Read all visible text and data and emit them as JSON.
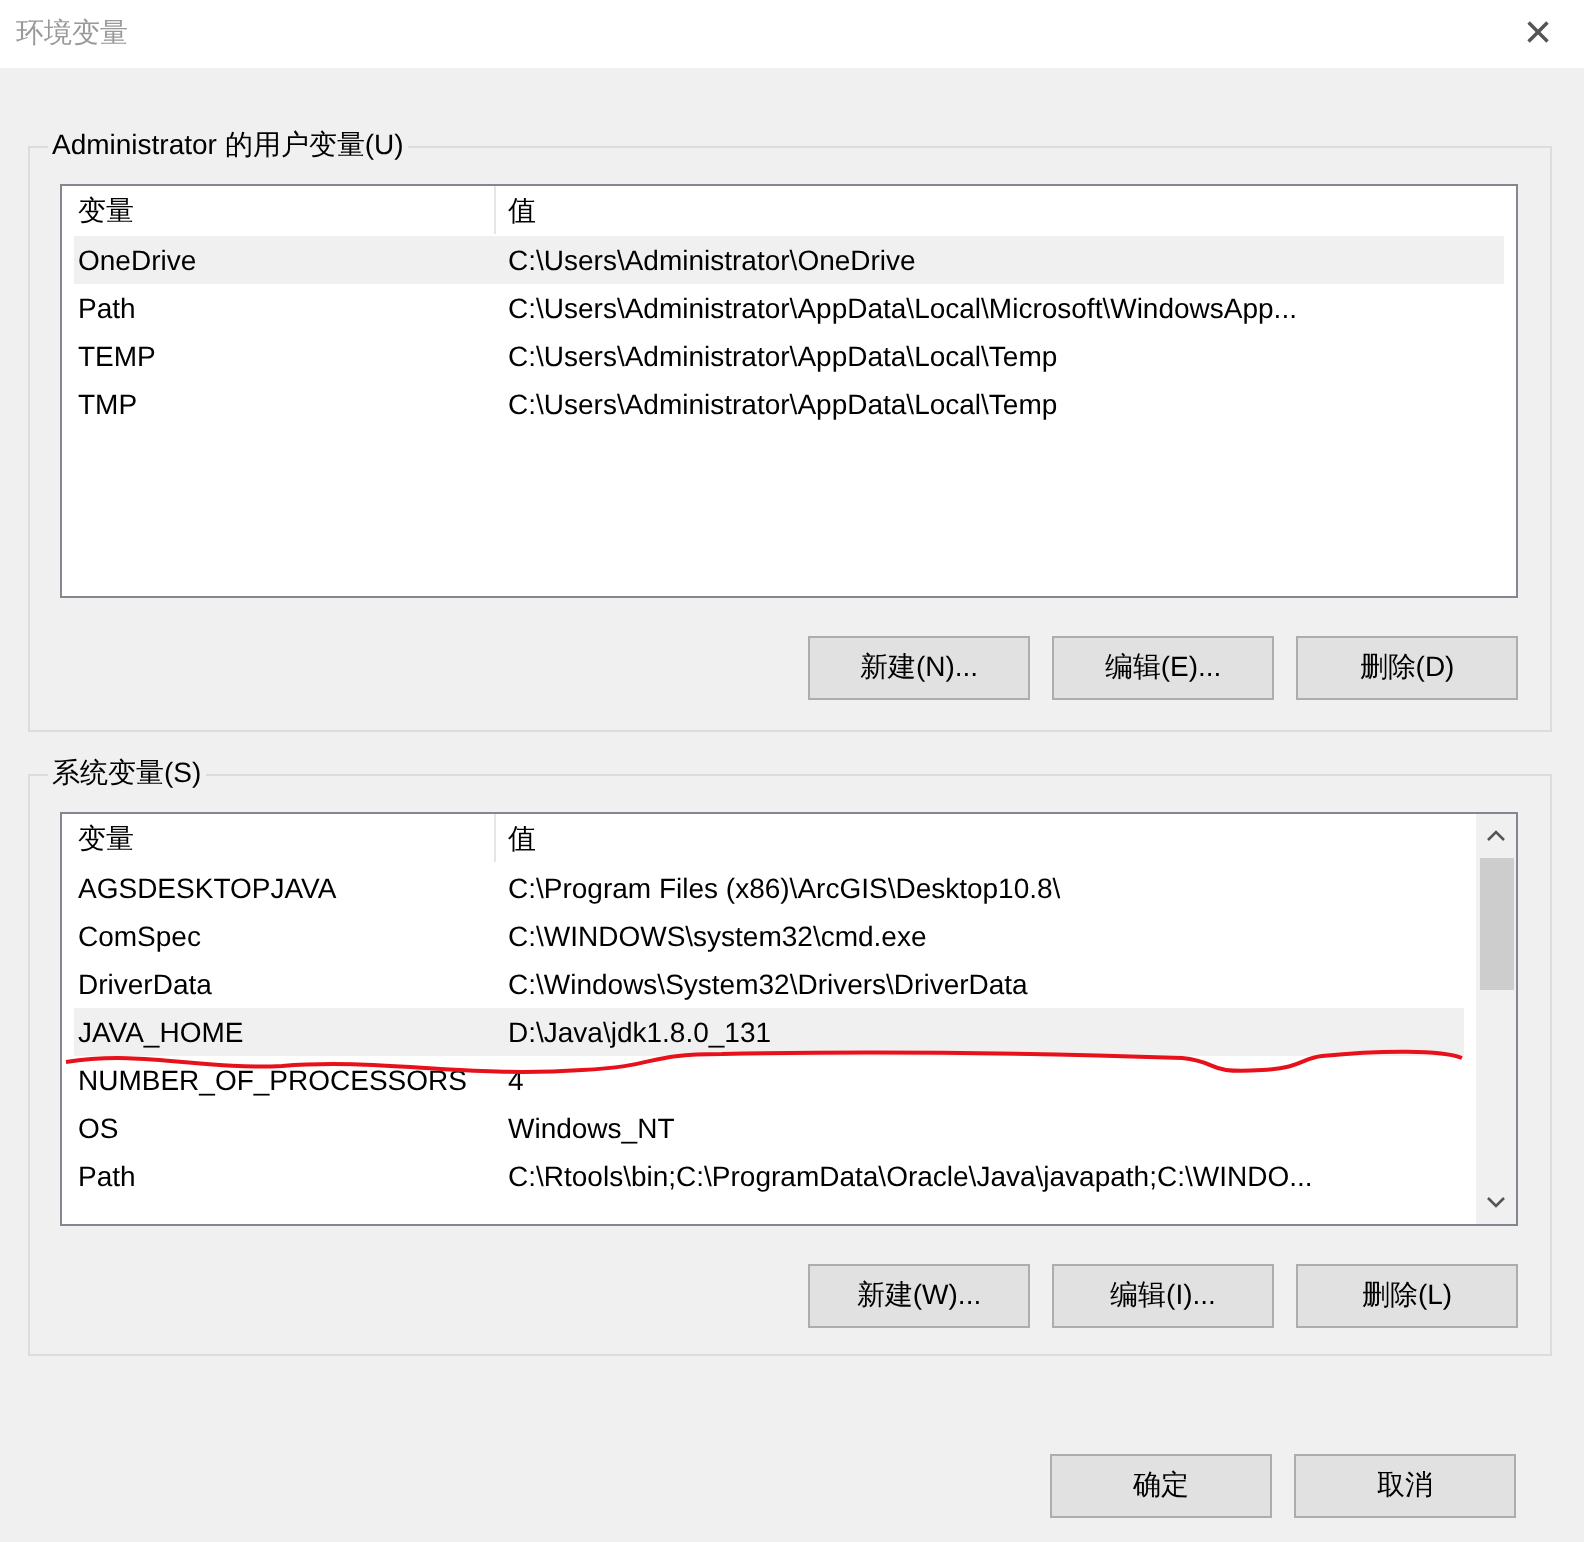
{
  "window": {
    "title": "环境变量",
    "close": "×"
  },
  "user_group": {
    "label": "Administrator 的用户变量(U)",
    "columns": [
      "变量",
      "值"
    ],
    "rows": [
      {
        "name": "OneDrive",
        "value": "C:\\Users\\Administrator\\OneDrive",
        "selected": true
      },
      {
        "name": "Path",
        "value": "C:\\Users\\Administrator\\AppData\\Local\\Microsoft\\WindowsApp...",
        "selected": false
      },
      {
        "name": "TEMP",
        "value": "C:\\Users\\Administrator\\AppData\\Local\\Temp",
        "selected": false
      },
      {
        "name": "TMP",
        "value": "C:\\Users\\Administrator\\AppData\\Local\\Temp",
        "selected": false
      }
    ],
    "buttons": [
      "新建(N)...",
      "编辑(E)...",
      "删除(D)"
    ]
  },
  "system_group": {
    "label": "系统变量(S)",
    "columns": [
      "变量",
      "值"
    ],
    "rows": [
      {
        "name": "AGSDESKTOPJAVA",
        "value": "C:\\Program Files (x86)\\ArcGIS\\Desktop10.8\\",
        "selected": false
      },
      {
        "name": "ComSpec",
        "value": "C:\\WINDOWS\\system32\\cmd.exe",
        "selected": false
      },
      {
        "name": "DriverData",
        "value": "C:\\Windows\\System32\\Drivers\\DriverData",
        "selected": false
      },
      {
        "name": "JAVA_HOME",
        "value": "D:\\Java\\jdk1.8.0_131",
        "selected": true
      },
      {
        "name": "NUMBER_OF_PROCESSORS",
        "value": "4",
        "selected": false
      },
      {
        "name": "OS",
        "value": "Windows_NT",
        "selected": false
      },
      {
        "name": "Path",
        "value": "C:\\Rtools\\bin;C:\\ProgramData\\Oracle\\Java\\javapath;C:\\WINDO...",
        "selected": false
      }
    ],
    "buttons": [
      "新建(W)...",
      "编辑(I)...",
      "删除(L)"
    ]
  },
  "footer_buttons": [
    "确定",
    "取消"
  ]
}
